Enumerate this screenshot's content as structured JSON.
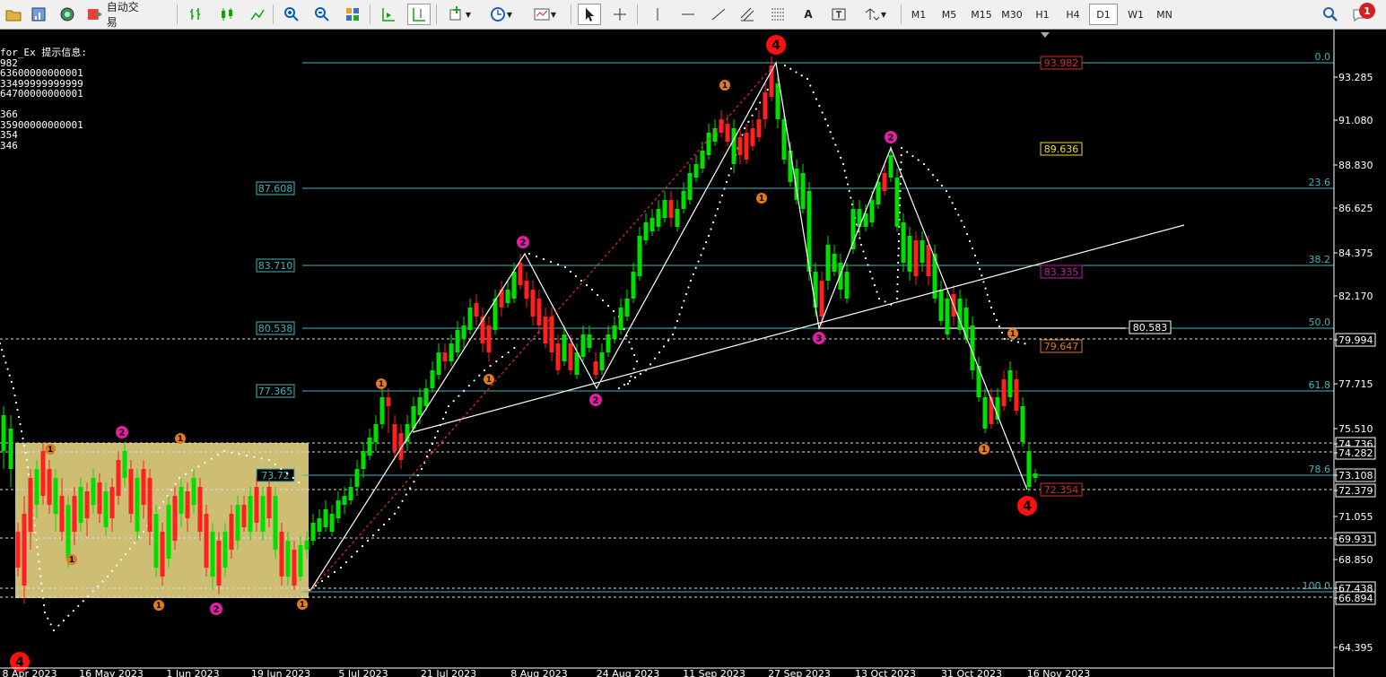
{
  "toolbar": {
    "autotrade_label": "自动交易",
    "timeframes": [
      "M1",
      "M5",
      "M15",
      "M30",
      "H1",
      "H4",
      "D1",
      "W1",
      "MN"
    ],
    "active_timeframe": "D1",
    "notification_count": "1"
  },
  "info_panel": {
    "lines": [
      "for_Ex 提示信息:",
      "982",
      "63600000000001",
      "33499999999999",
      "64700000000001",
      "",
      "366",
      "35900000000001",
      "354",
      "346"
    ]
  },
  "price_axis": {
    "ticks": [
      "93.285",
      "91.080",
      "88.830",
      "86.625",
      "84.375",
      "82.170",
      "79.994",
      "77.715",
      "75.510",
      "74.736",
      "74.282",
      "73.108",
      "72.379",
      "71.055",
      "69.931",
      "68.850",
      "67.438",
      "66.894",
      "64.395"
    ]
  },
  "date_axis": {
    "ticks": [
      "8 Apr 2023",
      "16 May 2023",
      "1 Jun 2023",
      "19 Jun 2023",
      "5 Jul 2023",
      "21 Jul 2023",
      "8 Aug 2023",
      "24 Aug 2023",
      "11 Sep 2023",
      "27 Sep 2023",
      "13 Oct 2023",
      "31 Oct 2023",
      "16 Nov 2023"
    ]
  },
  "fib_levels": {
    "pct": [
      "0.0",
      "23.6",
      "38.2",
      "50.0",
      "61.8",
      "78.6",
      "100.0"
    ],
    "prices": [
      "87.608",
      "83.710",
      "80.538",
      "77.365",
      "73.72"
    ]
  },
  "tags": {
    "top_red": "93.982",
    "yellow": "89.636",
    "magenta": "83.335",
    "white": "80.583",
    "orange": "79.647",
    "bottom_red": "72.354"
  },
  "wave_markers": {
    "four": "4",
    "two": "2",
    "one": "1",
    "three": "3"
  },
  "colors": {
    "bull": "#00e000",
    "bear": "#ff2020",
    "fib": "#3fb7b7",
    "box": "#d8c87a"
  }
}
